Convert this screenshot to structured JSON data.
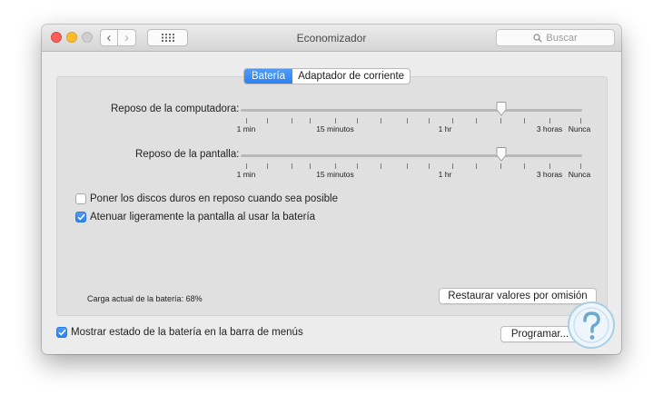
{
  "window": {
    "title": "Economizador",
    "search_placeholder": "Buscar"
  },
  "tabs": [
    {
      "label": "Batería",
      "active": true
    },
    {
      "label": "Adaptador de corriente",
      "active": false
    }
  ],
  "computer_sleep": {
    "label": "Reposo de la computadora:",
    "value_position": 0.763,
    "tick_labels": [
      "1 min",
      "15 minutos",
      "1 hr",
      "3 horas",
      "Nunca"
    ]
  },
  "display_sleep": {
    "label": "Reposo de la pantalla:",
    "value_position": 0.763,
    "tick_labels": [
      "1 min",
      "15 minutos",
      "1 hr",
      "3 horas",
      "Nunca"
    ]
  },
  "options": [
    {
      "label": "Poner los discos duros en reposo cuando sea posible",
      "checked": false
    },
    {
      "label": "Atenuar ligeramente la pantalla al usar la batería",
      "checked": true
    }
  ],
  "battery_status": "Carga actual de la batería: 68%",
  "restore_button": "Restaurar valores por omisión",
  "show_battery_menu": {
    "label": "Mostrar estado de la batería en la barra de menús",
    "checked": true
  },
  "schedule_button": "Programar...",
  "colors": {
    "accent": "#2c82f2",
    "window_bg": "#ececec",
    "panel_bg": "#e0e0e0"
  }
}
